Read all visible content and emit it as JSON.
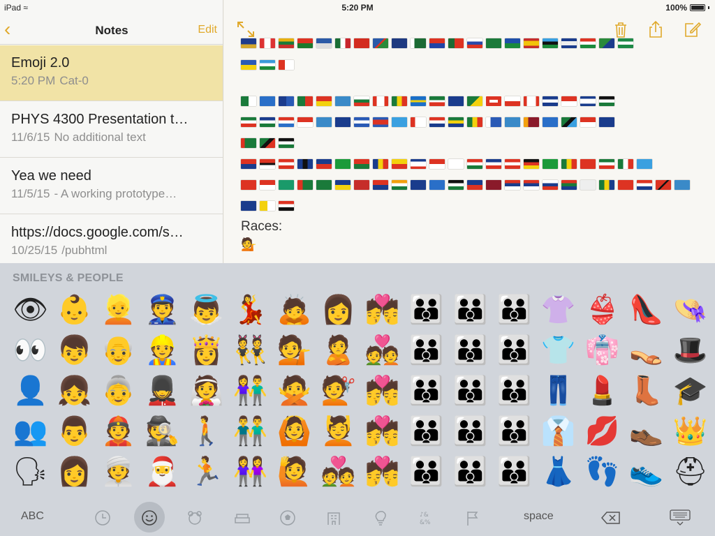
{
  "status": {
    "device": "iPad",
    "time": "5:20 PM",
    "battery": "100%"
  },
  "sidebar": {
    "title": "Notes",
    "edit_label": "Edit",
    "notes": [
      {
        "title": "Emoji 2.0",
        "date": "5:20 PM",
        "preview": "Cat-0"
      },
      {
        "title": "PHYS 4300 Presentation t…",
        "date": "11/6/15",
        "preview": "No additional text"
      },
      {
        "title": "Yea we need",
        "date": "11/5/15",
        "preview": "- A working prototype…"
      },
      {
        "title": "https://docs.google.com/s…",
        "date": "10/25/15",
        "preview": "/pubhtml"
      }
    ]
  },
  "editor": {
    "races_label": "Races:",
    "races_emoji": "💁"
  },
  "keyboard": {
    "category_title": "SMILEYS & PEOPLE",
    "abc_label": "ABC",
    "space_label": "space",
    "rows": [
      [
        "👁",
        "👶",
        "👱",
        "👮",
        "👼",
        "💃",
        "🙇",
        "👩",
        "💏",
        "👪",
        "👪",
        "👪",
        "👚",
        "👙",
        "👠",
        "👒"
      ],
      [
        "👀",
        "👦",
        "👴",
        "👷",
        "👸",
        "👯",
        "💁",
        "🙎",
        "💑",
        "👪",
        "👪",
        "👪",
        "👕",
        "👘",
        "👡",
        "🎩"
      ],
      [
        "👤",
        "👧",
        "👵",
        "💂",
        "👰",
        "👫",
        "🙅",
        "💇",
        "💏",
        "👪",
        "👪",
        "👪",
        "👖",
        "💄",
        "👢",
        "🎓"
      ],
      [
        "👥",
        "👨",
        "👲",
        "🕵",
        "🚶",
        "👬",
        "🙆",
        "💆",
        "💏",
        "👪",
        "👪",
        "👪",
        "👔",
        "💋",
        "👞",
        "👑"
      ],
      [
        "🗣",
        "👩",
        "👳",
        "🎅",
        "🏃",
        "👭",
        "🙋",
        "💑",
        "💏",
        "👪",
        "👪",
        "👪",
        "👗",
        "👣",
        "👟",
        "⛑"
      ]
    ]
  },
  "colors": {
    "accent": "#e0a92b",
    "selected_note": "#f1e3a6",
    "keyboard_bg": "#d1d5db"
  }
}
